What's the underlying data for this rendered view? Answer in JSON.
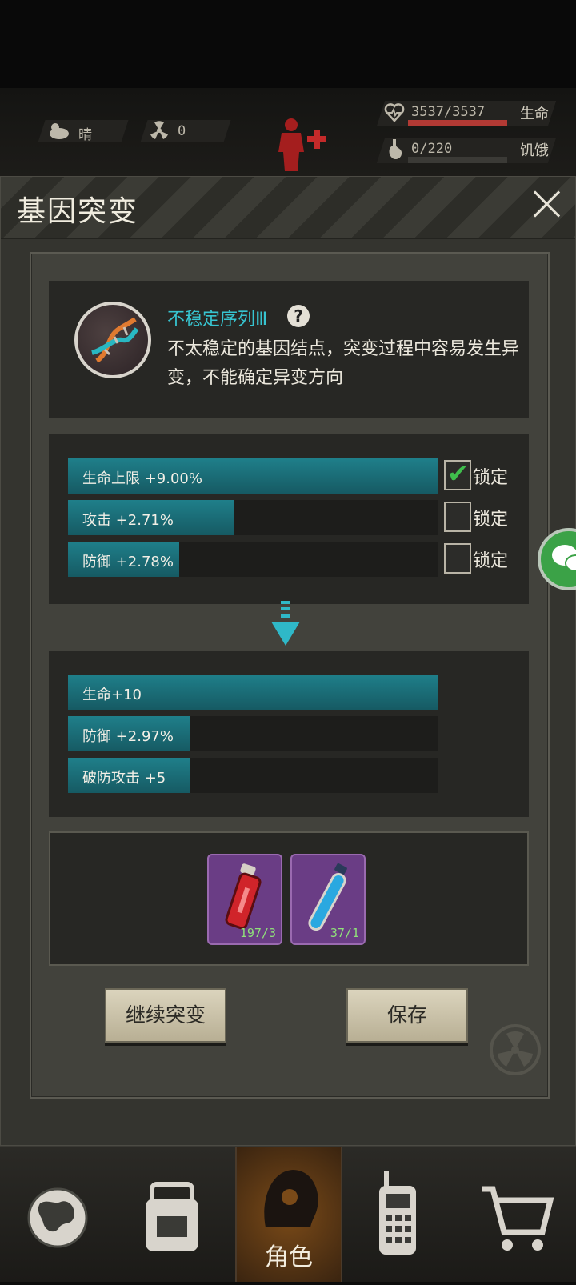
{
  "hud": {
    "weather": "晴",
    "radiation": "0",
    "hp_text": "3537/3537",
    "hp_label": "生命",
    "hp_fraction": 1.0,
    "hunger_text": "0/220",
    "hunger_label": "饥饿",
    "hunger_fraction": 0.0
  },
  "dialog": {
    "title": "基因突变",
    "gene": {
      "name": "不稳定序列Ⅲ",
      "help": "?",
      "description": "不太稳定的基因结点，突变过程中容易发生异变，不能确定异变方向"
    },
    "current_stats": [
      {
        "label": "生命上限 +9.00%",
        "fill": 1.0,
        "lock_label": "锁定",
        "locked": true
      },
      {
        "label": "攻击 +2.71%",
        "fill": 0.45,
        "lock_label": "锁定",
        "locked": false
      },
      {
        "label": "防御 +2.78%",
        "fill": 0.3,
        "lock_label": "锁定",
        "locked": false
      }
    ],
    "new_stats": [
      {
        "label": "生命+10",
        "fill": 1.0
      },
      {
        "label": "防御 +2.97%",
        "fill": 0.33
      },
      {
        "label": "破防攻击 +5",
        "fill": 0.33
      }
    ],
    "items": [
      {
        "name": "red-potion-icon",
        "count": "197/3"
      },
      {
        "name": "blue-tube-icon",
        "count": "37/1"
      }
    ],
    "continue_button": "继续突变",
    "save_button": "保存"
  },
  "nav": {
    "active_label": "角色"
  }
}
